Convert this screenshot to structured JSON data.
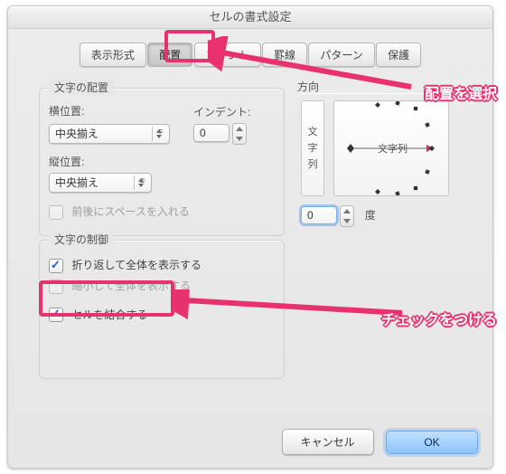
{
  "dialog": {
    "title": "セルの書式設定"
  },
  "tabs": {
    "items": [
      {
        "label": "表示形式"
      },
      {
        "label": "配置"
      },
      {
        "label": "フォント"
      },
      {
        "label": "罫線"
      },
      {
        "label": "パターン"
      },
      {
        "label": "保護"
      }
    ],
    "active_index": 1
  },
  "text_alignment": {
    "group_label": "文字の配置",
    "horizontal_label": "横位置:",
    "horizontal_value": "中央揃え",
    "indent_label": "インデント:",
    "indent_value": "0",
    "vertical_label": "縦位置:",
    "vertical_value": "中央揃え",
    "space_checkbox_label": "前後にスペースを入れる",
    "space_checkbox_checked": false,
    "space_checkbox_enabled": false
  },
  "text_control": {
    "group_label": "文字の制御",
    "wrap_label": "折り返して全体を表示する",
    "wrap_checked": true,
    "shrink_label": "縮小して全体を表示する",
    "shrink_checked": false,
    "shrink_enabled": false,
    "merge_label": "セルを結合する",
    "merge_checked": true
  },
  "orientation": {
    "group_label": "方向",
    "vertical_text": "文字列",
    "dial_text": "文字列",
    "degree_value": "0",
    "degree_unit": "度"
  },
  "footer": {
    "cancel": "キャンセル",
    "ok": "OK"
  },
  "annotations": {
    "select_tab": "配置を選択",
    "check_merge": "チェックをつける"
  },
  "colors": {
    "annotation": "#e8326e",
    "accent_blue": "#1a5fce"
  }
}
